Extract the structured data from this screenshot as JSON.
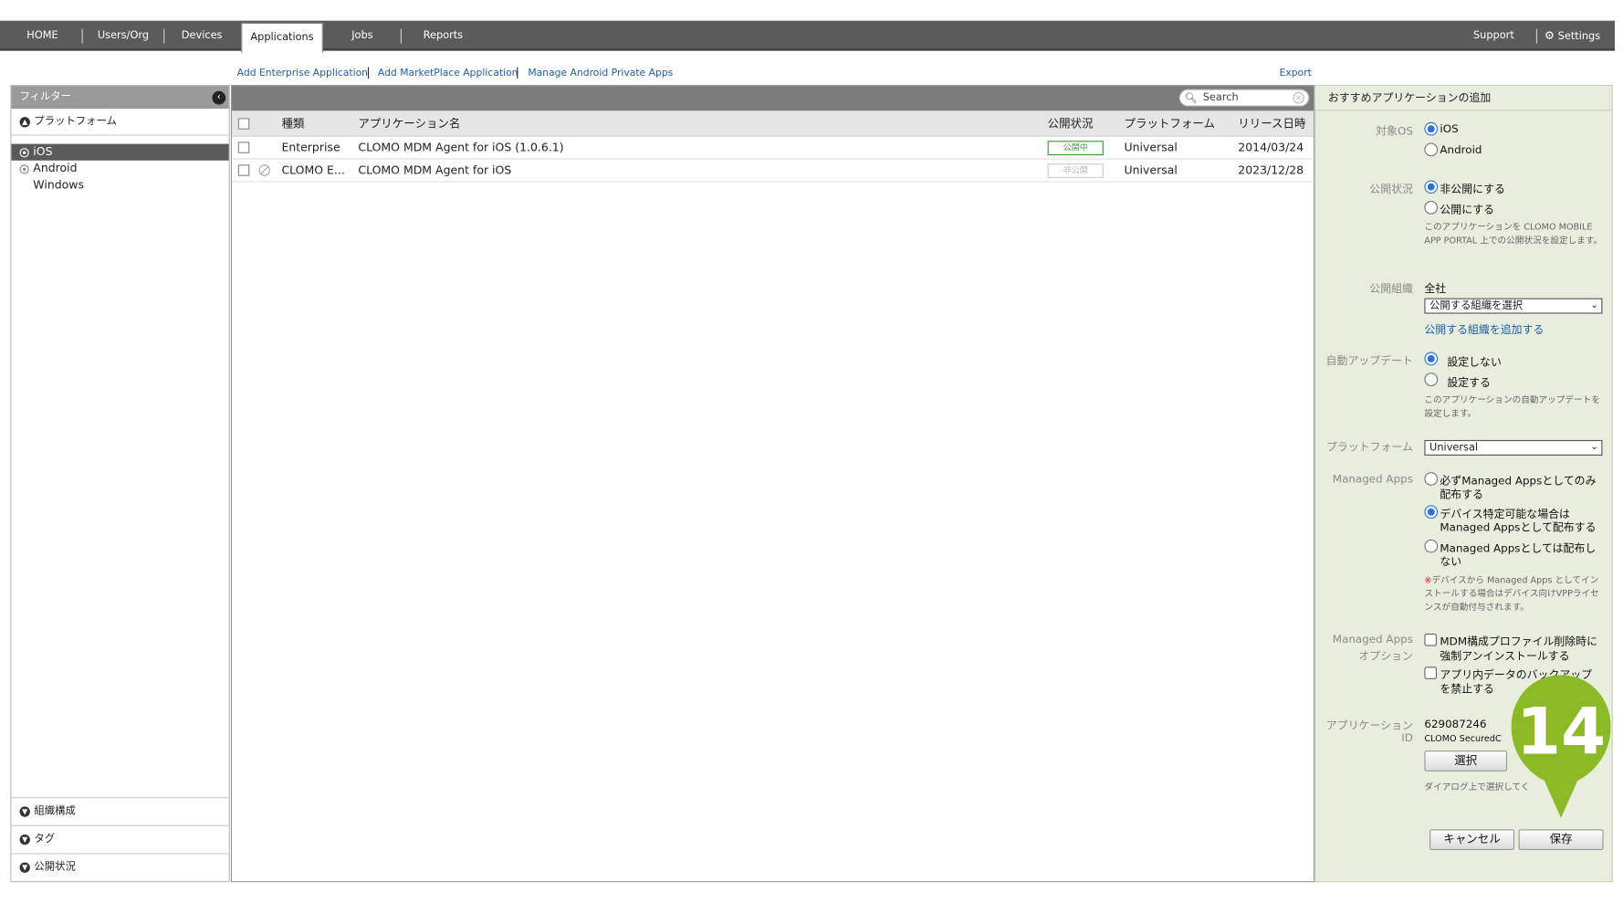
{
  "nav": {
    "tabs": [
      {
        "label": "HOME"
      },
      {
        "label": "Users/Org"
      },
      {
        "label": "Devices"
      },
      {
        "label": "Applications"
      },
      {
        "label": "Jobs"
      },
      {
        "label": "Reports"
      }
    ],
    "active_tab": "Applications",
    "support": "Support",
    "settings": "Settings"
  },
  "actions": {
    "add_enterprise": "Add Enterprise Application",
    "add_marketplace": "Add MarketPlace Application",
    "manage_android": "Manage Android Private Apps",
    "export": "Export"
  },
  "filter": {
    "title": "フィルター",
    "platform_section": "プラットフォーム",
    "platforms": [
      {
        "label": "iOS",
        "selected": true
      },
      {
        "label": "Android",
        "selected": false
      },
      {
        "label": "Windows",
        "selected": false
      }
    ],
    "bottom_sections": [
      {
        "label": "組織構成"
      },
      {
        "label": "タグ"
      },
      {
        "label": "公開状況"
      }
    ]
  },
  "table": {
    "search_placeholder": "Search",
    "columns": [
      "種類",
      "アプリケーション名",
      "公開状況",
      "プラットフォーム",
      "リリース日時"
    ],
    "rows": [
      {
        "type": "Enterprise",
        "name": "CLOMO MDM Agent for iOS (1.0.6.1)",
        "status": "公開中",
        "status_published": true,
        "platform": "Universal",
        "date": "2014/03/24",
        "disabled": false
      },
      {
        "type": "CLOMO E...",
        "name": "CLOMO MDM Agent for iOS",
        "status": "非公開",
        "status_published": false,
        "platform": "Universal",
        "date": "2023/12/28",
        "disabled": true
      }
    ]
  },
  "form": {
    "title": "おすすめアプリケーションの追加",
    "os_label": "対象OS",
    "os_options": [
      "iOS",
      "Android"
    ],
    "os_selected": "iOS",
    "publish_label": "公開状況",
    "publish_options": [
      "非公開にする",
      "公開にする"
    ],
    "publish_selected": "非公開にする",
    "publish_note": "このアプリケーションを CLOMO MOBILE APP PORTAL 上での公開状況を設定します。",
    "org_label": "公開組織",
    "org_value": "全社",
    "org_select": "公開する組織を選択",
    "org_add_link": "公開する組織を追加する",
    "autoupdate_label": "自動アップデート",
    "autoupdate_options": [
      "設定しない",
      "設定する"
    ],
    "autoupdate_selected": "設定しない",
    "autoupdate_note": "このアプリケーションの自動アップデートを設定します。",
    "platform_label": "プラットフォーム",
    "platform_select": "Universal",
    "managed_label": "Managed Apps",
    "managed_options": [
      {
        "line1": "必ずManaged Appsとしてのみ",
        "line2": "配布する"
      },
      {
        "line1": "デバイス特定可能な場合は",
        "line2": "Managed Appsとして配布する"
      },
      {
        "line1": "Managed Appsとしては配布し",
        "line2": "ない"
      }
    ],
    "managed_selected_index": 1,
    "managed_note_mark": "※",
    "managed_note": "デバイスから Managed Apps としてインストールする場合はデバイス向けVPPライセンスが自動付与されます。",
    "managed_opt_label1": "Managed Apps",
    "managed_opt_label2": "オプション",
    "managed_opts": [
      {
        "line1": "MDM構成プロファイル削除時に",
        "line2": "強制アンインストールする",
        "checked": false
      },
      {
        "line1": "アプリ内データのバックアップ",
        "line2": "を禁止する",
        "checked": false
      }
    ],
    "appid_label1": "アプリケーション",
    "appid_label2": "ID",
    "appid_value": "629087246",
    "appid_name": "CLOMO SecuredC",
    "select_button": "選択",
    "dialog_note": "ダイアログ上で選択してく",
    "cancel_button": "キャンセル",
    "save_button": "保存"
  },
  "callout": {
    "number": "14",
    "color": "#8cb926"
  }
}
